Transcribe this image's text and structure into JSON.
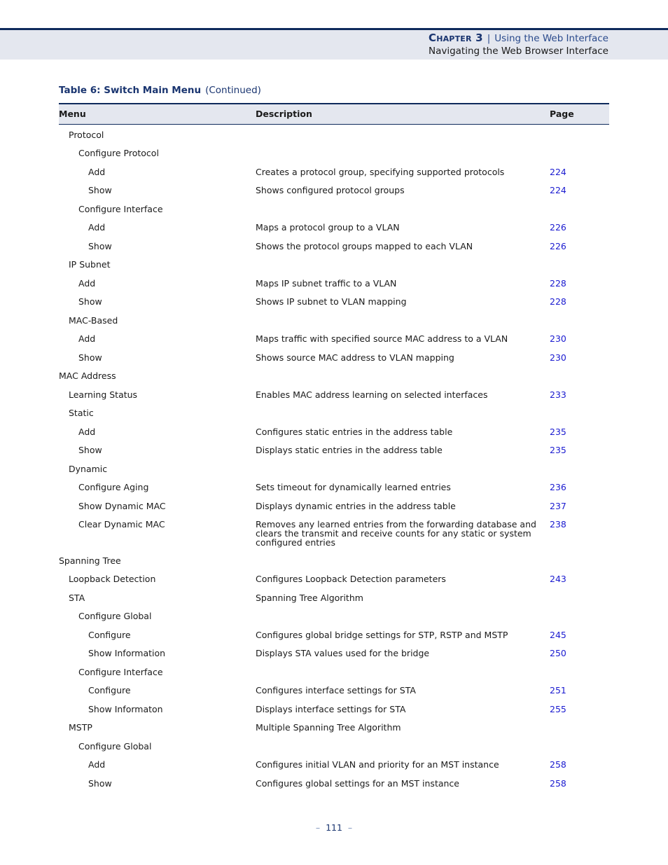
{
  "header": {
    "chapter_label": "Chapter 3",
    "separator": "|",
    "chapter_title": "Using the Web Interface",
    "section_title": "Navigating the Web Browser Interface"
  },
  "table": {
    "caption": "Table 6: Switch Main Menu",
    "caption_suffix": "(Continued)",
    "columns": [
      "Menu",
      "Description",
      "Page"
    ],
    "rows": [
      {
        "level": 1,
        "menu": "Protocol",
        "description": "",
        "page": ""
      },
      {
        "level": 2,
        "menu": "Configure Protocol",
        "description": "",
        "page": ""
      },
      {
        "level": 3,
        "menu": "Add",
        "description": "Creates a protocol group, specifying supported protocols",
        "page": "224"
      },
      {
        "level": 3,
        "menu": "Show",
        "description": "Shows configured protocol groups",
        "page": "224"
      },
      {
        "level": 2,
        "menu": "Configure Interface",
        "description": "",
        "page": ""
      },
      {
        "level": 3,
        "menu": "Add",
        "description": "Maps a protocol group to a VLAN",
        "page": "226"
      },
      {
        "level": 3,
        "menu": "Show",
        "description": "Shows the protocol groups mapped to each VLAN",
        "page": "226"
      },
      {
        "level": 1,
        "menu": "IP Subnet",
        "description": "",
        "page": ""
      },
      {
        "level": 2,
        "menu": "Add",
        "description": "Maps IP subnet traffic to a VLAN",
        "page": "228"
      },
      {
        "level": 2,
        "menu": "Show",
        "description": "Shows IP subnet to VLAN mapping",
        "page": "228"
      },
      {
        "level": 1,
        "menu": "MAC-Based",
        "description": "",
        "page": ""
      },
      {
        "level": 2,
        "menu": "Add",
        "description": "Maps traffic with specified source MAC address to a VLAN",
        "page": "230"
      },
      {
        "level": 2,
        "menu": "Show",
        "description": "Shows source MAC address to VLAN mapping",
        "page": "230"
      },
      {
        "level": 0,
        "menu": "MAC Address",
        "description": "",
        "page": ""
      },
      {
        "level": 1,
        "menu": "Learning Status",
        "description": "Enables MAC address learning on selected interfaces",
        "page": "233"
      },
      {
        "level": 1,
        "menu": "Static",
        "description": "",
        "page": ""
      },
      {
        "level": 2,
        "menu": "Add",
        "description": "Configures static entries in the address table",
        "page": "235"
      },
      {
        "level": 2,
        "menu": "Show",
        "description": "Displays static entries in the address table",
        "page": "235"
      },
      {
        "level": 1,
        "menu": "Dynamic",
        "description": "",
        "page": ""
      },
      {
        "level": 2,
        "menu": "Configure Aging",
        "description": "Sets timeout for dynamically learned entries",
        "page": "236"
      },
      {
        "level": 2,
        "menu": "Show Dynamic MAC",
        "description": "Displays dynamic entries in the address table",
        "page": "237"
      },
      {
        "level": 2,
        "menu": "Clear Dynamic MAC",
        "description": "Removes any learned entries from the forwarding database and clears the transmit and receive counts for any static or system configured entries",
        "page": "238"
      },
      {
        "level": 0,
        "menu": "Spanning Tree",
        "description": "",
        "page": ""
      },
      {
        "level": 1,
        "menu": "Loopback Detection",
        "description": "Configures Loopback Detection parameters",
        "page": "243"
      },
      {
        "level": 1,
        "menu": "STA",
        "description": "Spanning Tree Algorithm",
        "page": ""
      },
      {
        "level": 2,
        "menu": "Configure Global",
        "description": "",
        "page": ""
      },
      {
        "level": 3,
        "menu": "Configure",
        "description": "Configures global bridge settings for STP, RSTP and MSTP",
        "page": "245"
      },
      {
        "level": 3,
        "menu": "Show Information",
        "description": "Displays STA values used for the bridge",
        "page": "250"
      },
      {
        "level": 2,
        "menu": "Configure Interface",
        "description": "",
        "page": ""
      },
      {
        "level": 3,
        "menu": "Configure",
        "description": "Configures interface settings for STA",
        "page": "251"
      },
      {
        "level": 3,
        "menu": "Show Informaton",
        "description": "Displays interface settings for STA",
        "page": "255"
      },
      {
        "level": 1,
        "menu": "MSTP",
        "description": "Multiple Spanning Tree Algorithm",
        "page": ""
      },
      {
        "level": 2,
        "menu": "Configure Global",
        "description": "",
        "page": ""
      },
      {
        "level": 3,
        "menu": "Add",
        "description": "Configures initial VLAN and priority for an MST instance",
        "page": "258"
      },
      {
        "level": 3,
        "menu": "Show",
        "description": "Configures global settings for an MST instance",
        "page": "258"
      }
    ]
  },
  "footer": {
    "page_number": "111",
    "dash": "–"
  }
}
